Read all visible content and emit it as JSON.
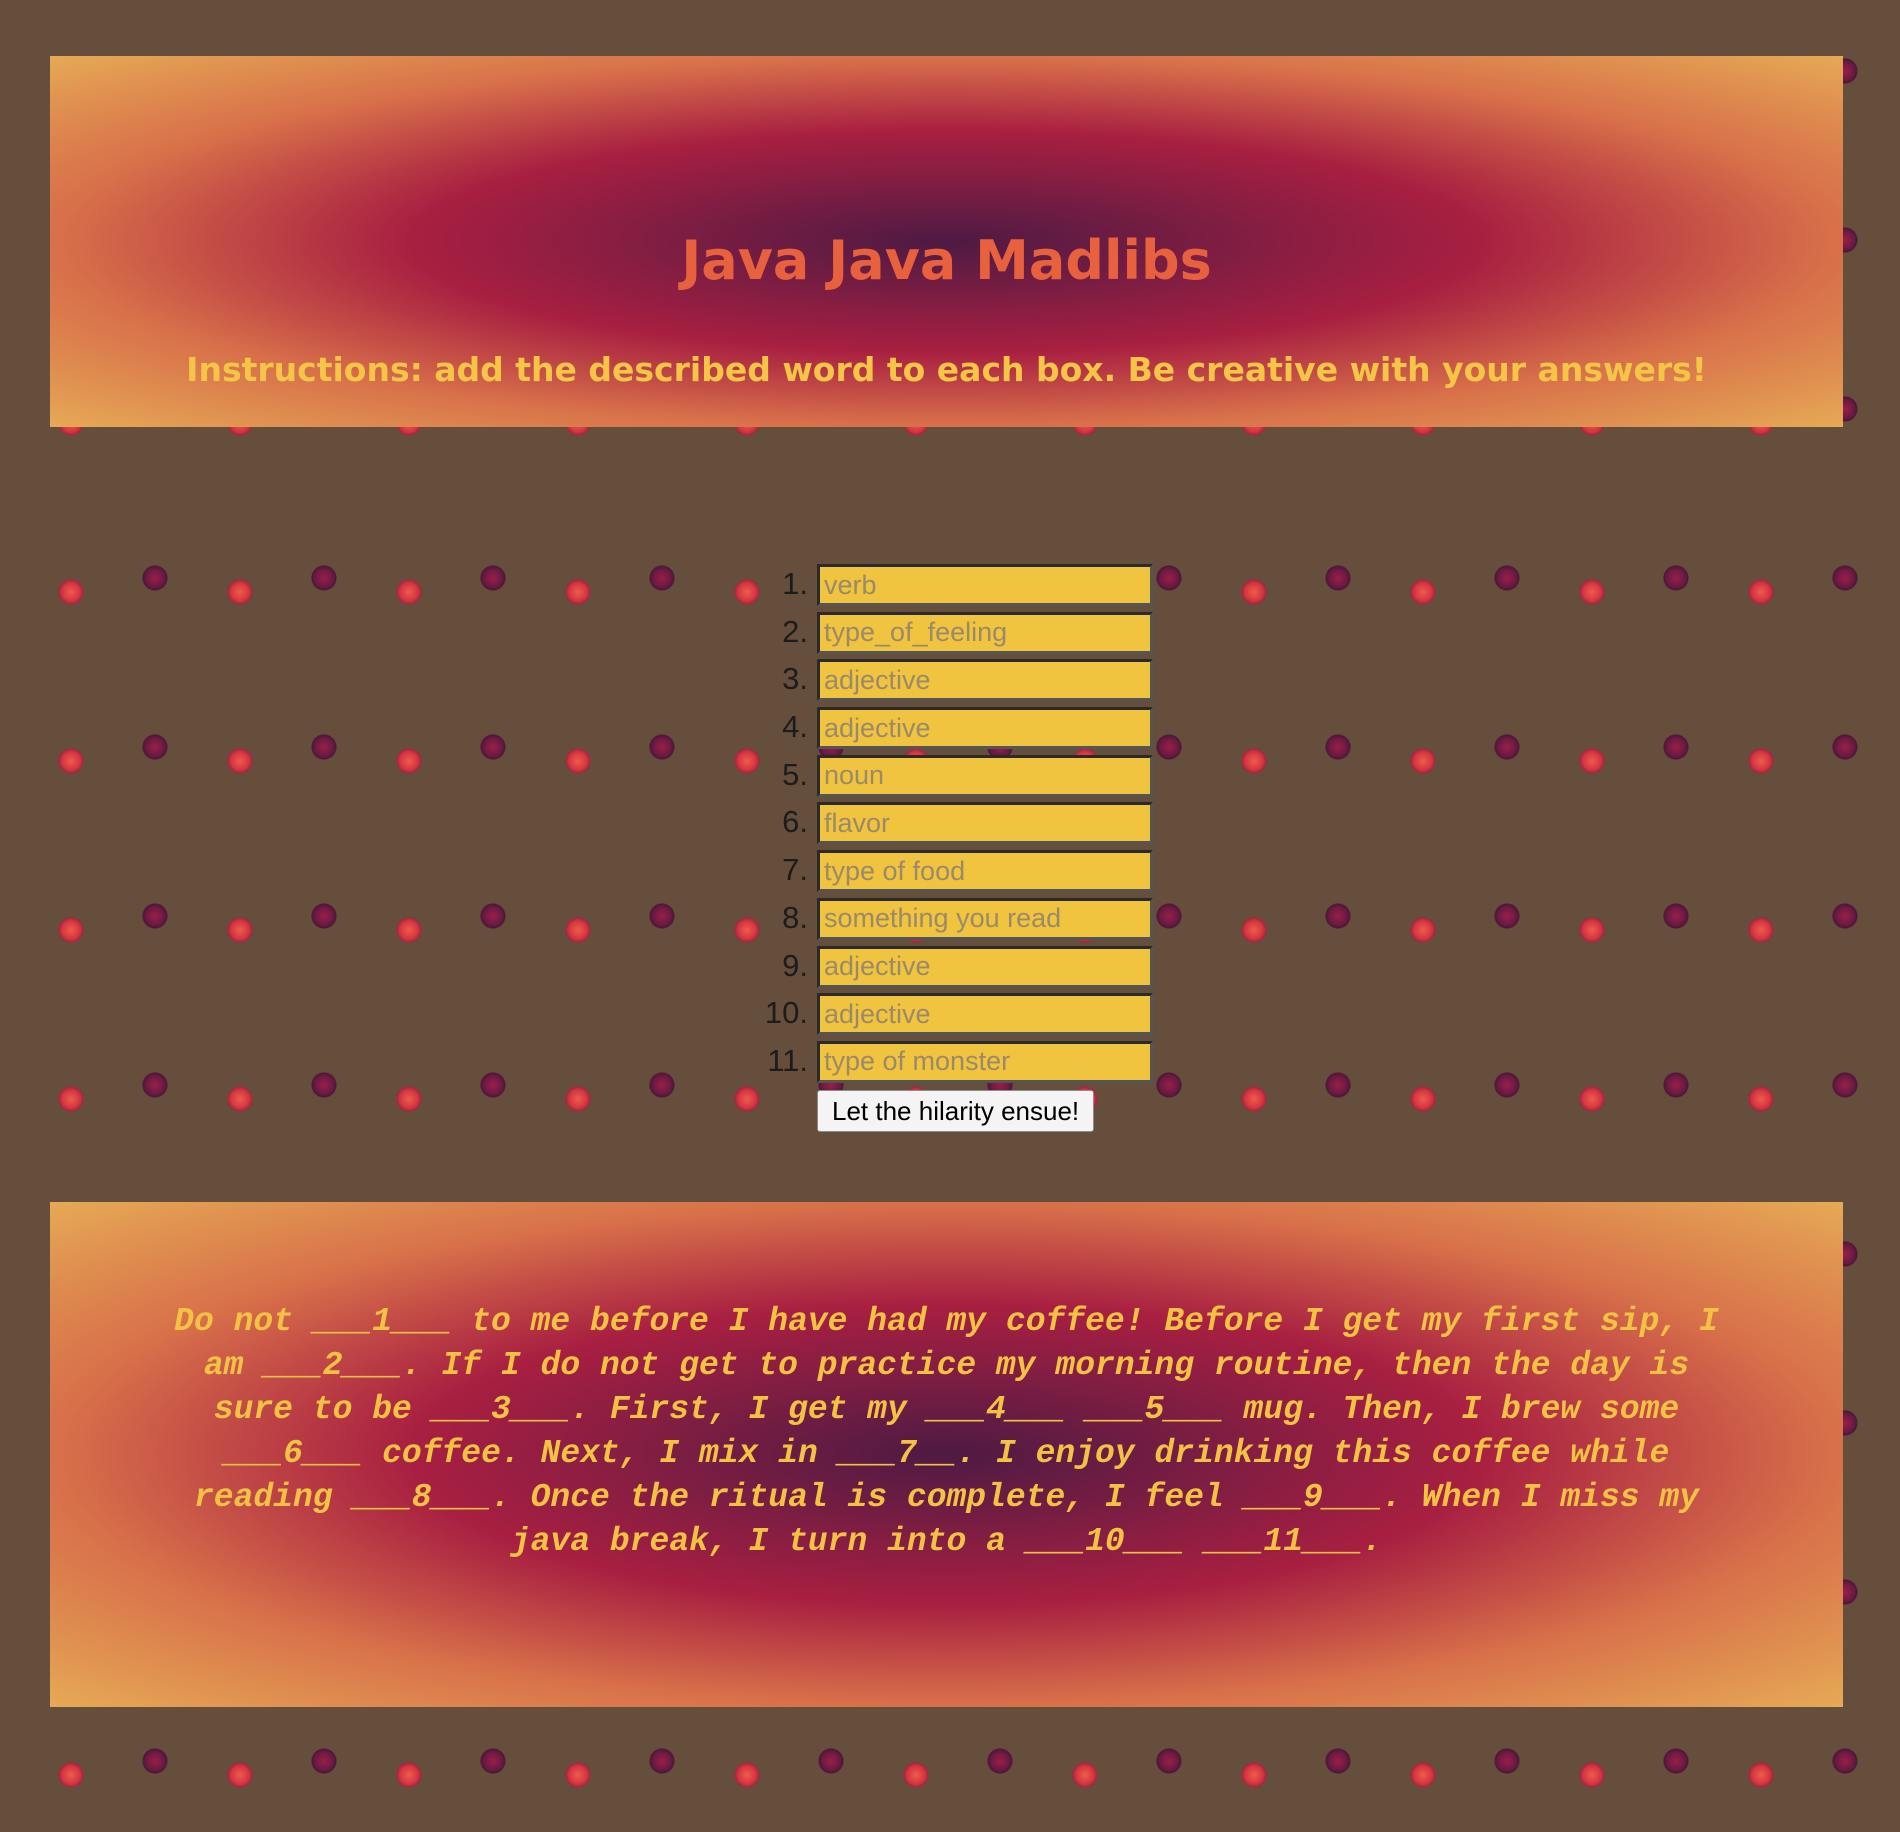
{
  "header": {
    "title": "Java Java Madlibs",
    "instructions": "Instructions: add the described word to each box. Be creative with your answers!"
  },
  "form": {
    "fields": [
      {
        "number": "1.",
        "placeholder": "verb",
        "value": ""
      },
      {
        "number": "2.",
        "placeholder": "type_of_feeling",
        "value": ""
      },
      {
        "number": "3.",
        "placeholder": "adjective",
        "value": ""
      },
      {
        "number": "4.",
        "placeholder": "adjective",
        "value": ""
      },
      {
        "number": "5.",
        "placeholder": "noun",
        "value": ""
      },
      {
        "number": "6.",
        "placeholder": "flavor",
        "value": ""
      },
      {
        "number": "7.",
        "placeholder": "type of food",
        "value": ""
      },
      {
        "number": "8.",
        "placeholder": "something you read",
        "value": ""
      },
      {
        "number": "9.",
        "placeholder": "adjective",
        "value": ""
      },
      {
        "number": "10.",
        "placeholder": "adjective",
        "value": ""
      },
      {
        "number": "11.",
        "placeholder": "type of monster",
        "value": ""
      }
    ],
    "submit_label": "Let the hilarity ensue!"
  },
  "story": {
    "text": "Do not ___1___ to me before I have had my coffee! Before I get my first sip, I am ___2___. If I do not get to practice my morning routine, then the day is sure to be ___3___. First, I get my ___4___ ___5___ mug. Then, I brew some ___6___ coffee. Next, I mix in ___7__. I enjoy drinking this coffee while reading ___8___. Once the ritual is complete, I feel ___9___. When I miss my java break, I turn into a ___10___ ___11___."
  },
  "colors": {
    "page_background": "#654e3b",
    "title": "#e8613f",
    "instructions": "#f4c547",
    "input_background": "#f0c43f",
    "story_text": "#f2c244"
  }
}
